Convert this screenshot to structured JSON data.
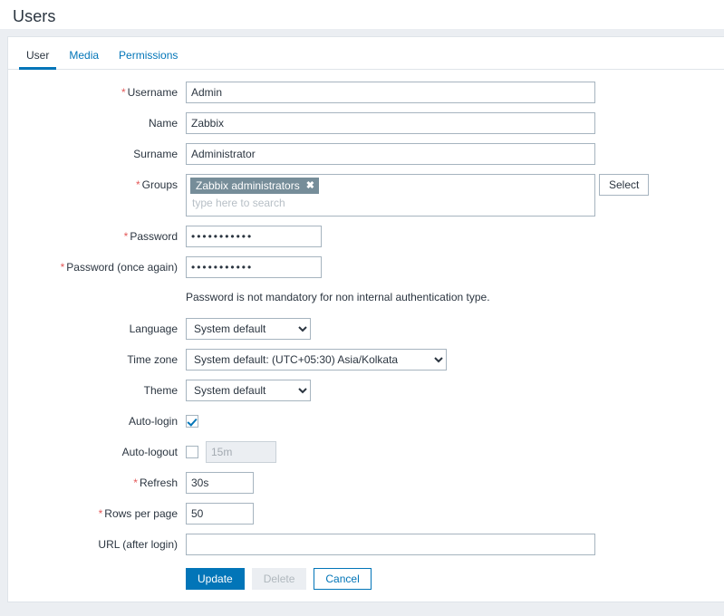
{
  "header": {
    "title": "Users"
  },
  "tabs": [
    {
      "label": "User",
      "active": true
    },
    {
      "label": "Media",
      "active": false
    },
    {
      "label": "Permissions",
      "active": false
    }
  ],
  "form": {
    "username": {
      "label": "Username",
      "required": true,
      "value": "Admin"
    },
    "name": {
      "label": "Name",
      "required": false,
      "value": "Zabbix"
    },
    "surname": {
      "label": "Surname",
      "required": false,
      "value": "Administrator"
    },
    "groups": {
      "label": "Groups",
      "required": true,
      "chips": [
        "Zabbix administrators"
      ],
      "placeholder": "type here to search",
      "select_button": "Select"
    },
    "password": {
      "label": "Password",
      "required": true,
      "value": "•••••••••••"
    },
    "password_again": {
      "label": "Password (once again)",
      "required": true,
      "value": "•••••••••••"
    },
    "password_hint": "Password is not mandatory for non internal authentication type.",
    "language": {
      "label": "Language",
      "value": "System default"
    },
    "timezone": {
      "label": "Time zone",
      "value": "System default: (UTC+05:30) Asia/Kolkata"
    },
    "theme": {
      "label": "Theme",
      "value": "System default"
    },
    "auto_login": {
      "label": "Auto-login",
      "checked": true
    },
    "auto_logout": {
      "label": "Auto-logout",
      "checked": false,
      "value": "15m"
    },
    "refresh": {
      "label": "Refresh",
      "required": true,
      "value": "30s"
    },
    "rows_per_page": {
      "label": "Rows per page",
      "required": true,
      "value": "50"
    },
    "url_after_login": {
      "label": "URL (after login)",
      "required": false,
      "value": ""
    }
  },
  "footer": {
    "update": "Update",
    "delete": "Delete",
    "cancel": "Cancel"
  },
  "colors": {
    "accent": "#0275b8",
    "required": "#e45959",
    "chip_bg": "#768d99",
    "page_bg": "#ebeef2"
  }
}
